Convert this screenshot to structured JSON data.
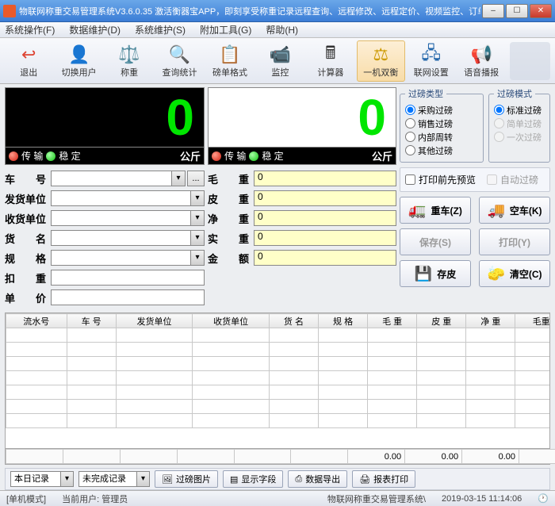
{
  "window": {
    "title": "物联网称重交易管理系统V3.6.0.35 激活衡器宝APP，即刻享受称重记录远程查询、远程修改、远程定价、视频监控、订单查询、称重作弊报警和称重审核等功…"
  },
  "menu": {
    "items": [
      "系统操作(F)",
      "数据维护(D)",
      "系统维护(S)",
      "附加工具(G)",
      "帮助(H)"
    ]
  },
  "toolbar": {
    "items": [
      {
        "icon": "↩",
        "label": "退出",
        "color": "#d43"
      },
      {
        "icon": "👤",
        "label": "切换用户",
        "color": "#e89a2a"
      },
      {
        "icon": "⚖️",
        "label": "称重",
        "color": "#2a8"
      },
      {
        "icon": "🔍",
        "label": "查询统计",
        "color": "#e86"
      },
      {
        "icon": "📋",
        "label": "磅单格式",
        "color": "#57a"
      },
      {
        "icon": "📹",
        "label": "监控",
        "color": "#555"
      },
      {
        "icon": "🖩",
        "label": "计算器",
        "color": "#333"
      },
      {
        "icon": "⚖",
        "label": "一机双衡",
        "color": "#c90",
        "active": true
      },
      {
        "icon": "🖧",
        "label": "联网设置",
        "color": "#26a"
      },
      {
        "icon": "📢",
        "label": "语音播报",
        "color": "#a55"
      }
    ]
  },
  "display": {
    "left": "0",
    "right": "0"
  },
  "status": {
    "transmit": "传 输",
    "stable": "稳 定",
    "unit": "公斤"
  },
  "leftform": {
    "rows": [
      {
        "label": "车  号",
        "type": "combo",
        "dots": true
      },
      {
        "label": "发货单位",
        "type": "combo"
      },
      {
        "label": "收货单位",
        "type": "combo"
      },
      {
        "label": "货  名",
        "type": "combo"
      },
      {
        "label": "规  格",
        "type": "combo"
      },
      {
        "label": "扣  重",
        "type": "input"
      },
      {
        "label": "单  价",
        "type": "input"
      }
    ]
  },
  "midform": {
    "rows": [
      {
        "label": "毛  重",
        "value": "0"
      },
      {
        "label": "皮  重",
        "value": "0"
      },
      {
        "label": "净  重",
        "value": "0"
      },
      {
        "label": "实  重",
        "value": "0"
      },
      {
        "label": "金  额",
        "value": "0"
      }
    ]
  },
  "groups": {
    "type": {
      "legend": "过磅类型",
      "items": [
        "采购过磅",
        "销售过磅",
        "内部周转",
        "其他过磅"
      ],
      "selected": 0
    },
    "mode": {
      "legend": "过磅模式",
      "items": [
        "标准过磅",
        "简单过磅",
        "一次过磅"
      ],
      "selected": 0
    }
  },
  "checks": {
    "preview": "打印前先预览",
    "auto": "自动过磅"
  },
  "buttons": {
    "heavy": "重车(Z)",
    "empty": "空车(K)",
    "save": "保存(S)",
    "print": "打印(Y)",
    "tare": "存皮",
    "clear": "清空(C)"
  },
  "table": {
    "headers": [
      "流水号",
      "车  号",
      "发货单位",
      "收货单位",
      "货  名",
      "规  格",
      "毛  重",
      "皮  重",
      "净  重",
      "毛重时"
    ],
    "totals": [
      "",
      "",
      "",
      "",
      "",
      "",
      "0.00",
      "0.00",
      "0.00",
      ""
    ]
  },
  "bottom": {
    "combo1": "本日记录",
    "combo2": "未完成记录",
    "btn1": "过磅图片",
    "btn2": "显示字段",
    "btn3": "数据导出",
    "btn4": "报表打印"
  },
  "statusbar": {
    "mode": "[单机模式]",
    "user": "当前用户: 管理员",
    "app": "物联网称重交易管理系统\\",
    "time": "2019-03-15 11:14:06"
  }
}
